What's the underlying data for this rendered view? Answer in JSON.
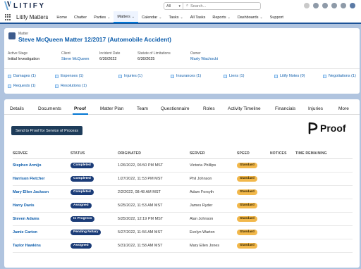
{
  "header": {
    "logo_text": "LITIFY",
    "search_scope": "All",
    "search_placeholder": "Search..."
  },
  "nav": {
    "app_name": "Litify Matters",
    "items": [
      {
        "label": "Home",
        "caret": false,
        "active": false
      },
      {
        "label": "Chatter",
        "caret": false,
        "active": false
      },
      {
        "label": "Parties",
        "caret": true,
        "active": false
      },
      {
        "label": "Matters",
        "caret": true,
        "active": true
      },
      {
        "label": "Calendar",
        "caret": true,
        "active": false
      },
      {
        "label": "Tasks",
        "caret": true,
        "active": false
      },
      {
        "label": "All Tasks",
        "caret": false,
        "active": false
      },
      {
        "label": "Reports",
        "caret": true,
        "active": false
      },
      {
        "label": "Dashboards",
        "caret": true,
        "active": false
      },
      {
        "label": "Support",
        "caret": false,
        "active": false
      }
    ]
  },
  "record": {
    "type": "Matter",
    "title": "Steve McQueen Matter 12/2017 (Automobile Accident)",
    "fields": [
      {
        "label": "Active Stage",
        "value": "Initial Investigation",
        "link": false
      },
      {
        "label": "Client",
        "value": "Steve McQueen",
        "link": true
      },
      {
        "label": "Incident Date",
        "value": "6/30/2022",
        "link": false
      },
      {
        "label": "Statute of Limitations",
        "value": "6/30/2025",
        "link": false
      },
      {
        "label": "Owner",
        "value": "Marty Wachocki",
        "link": true
      }
    ],
    "related": [
      "Damages (1)",
      "Expenses (1)",
      "Injuries (1)",
      "Insurances (1)",
      "Liens (1)",
      "Litify Notes (0)",
      "Negotiations (1)",
      "Requests (1)",
      "Resolutions (1)"
    ]
  },
  "tabs": [
    "Details",
    "Documents",
    "Proof",
    "Matter Plan",
    "Team",
    "Questionnaire",
    "Roles",
    "Activity Timeline",
    "Financials",
    "Injuries",
    "More"
  ],
  "active_tab": "Proof",
  "proof": {
    "send_button": "Send to Proof for Service of Process",
    "logo_text": "Proof",
    "columns": [
      "SERVEE",
      "STATUS",
      "ORIGINATED",
      "SERVER",
      "SPEED",
      "NOTICES",
      "TIME REMAINING"
    ],
    "rows": [
      {
        "servee": "Stephen Armijo",
        "status": "Completed",
        "originated": "1/26/2022, 06:50 PM MST",
        "server": "Victoria Phillips",
        "speed": "Standard"
      },
      {
        "servee": "Harrison Fletcher",
        "status": "Completed",
        "originated": "1/27/2022, 11:53 PM MST",
        "server": "Phil Johnson",
        "speed": "Standard"
      },
      {
        "servee": "Mary Ellen Jackson",
        "status": "Completed",
        "originated": "2/2/2022, 08:48 AM MST",
        "server": "Adam Forsyth",
        "speed": "Standard"
      },
      {
        "servee": "Harry Davis",
        "status": "Assigned",
        "originated": "5/25/2022, 11:53 AM MST",
        "server": "James Ryder",
        "speed": "Standard"
      },
      {
        "servee": "Steven Adams",
        "status": "In Progress",
        "originated": "5/25/2022, 12:19 PM MST",
        "server": "Alan Johnson",
        "speed": "Standard"
      },
      {
        "servee": "Jamie Carton",
        "status": "Pending Notary",
        "originated": "5/27/2022, 11:56 AM MST",
        "server": "Evelyn Warton",
        "speed": "Standard"
      },
      {
        "servee": "Taylor Hawkins",
        "status": "Assigned",
        "originated": "5/31/2022, 11:58 AM MST",
        "server": "Mary Ellen Jones",
        "speed": "Standard"
      }
    ]
  },
  "colors": {
    "brand_navy": "#1b2b4b",
    "link_blue": "#0b5cab",
    "status_pill": "#1b3c78",
    "speed_pill": "#f2b84b",
    "page_bg": "#b0c4df"
  }
}
